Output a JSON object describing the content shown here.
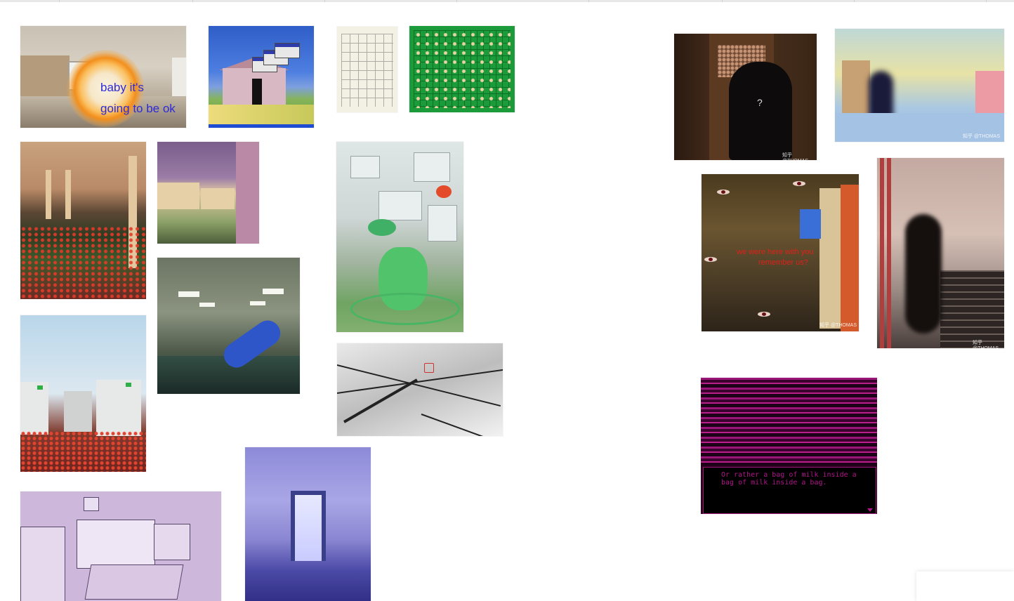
{
  "board": {
    "images": [
      {
        "id": "kitchen-glow",
        "caption_lines": [
          "baby it's",
          "going to be ok"
        ]
      },
      {
        "id": "pink-house-windows"
      },
      {
        "id": "game-sheet"
      },
      {
        "id": "green-maze"
      },
      {
        "id": "flower-hall"
      },
      {
        "id": "mauve-houses"
      },
      {
        "id": "pool-slide"
      },
      {
        "id": "green-vapor"
      },
      {
        "id": "manga-room"
      },
      {
        "id": "white-walls-flowers"
      },
      {
        "id": "purple-bedroom"
      },
      {
        "id": "fog-door"
      },
      {
        "id": "door-figure",
        "mark": "?",
        "watermark": "知乎 @THOMAS"
      },
      {
        "id": "kindergarten",
        "watermark": "知乎 @THOMAS"
      },
      {
        "id": "eyes-hallway",
        "caption_lines": [
          "we were here with you",
          "remember us?"
        ],
        "watermark": "知乎 @THOMAS"
      },
      {
        "id": "stair-figure",
        "watermark": "知乎 @THOMAS"
      },
      {
        "id": "pixel-store",
        "caption_lines": [
          "Or rather a bag of milk inside a",
          "bag of milk inside a bag."
        ]
      }
    ]
  },
  "colors": {
    "background": "#ffffff",
    "kitchen_caption": "#2d2ad8",
    "hallway_caption": "#e0201a",
    "pixel_caption": "#b0158a"
  }
}
